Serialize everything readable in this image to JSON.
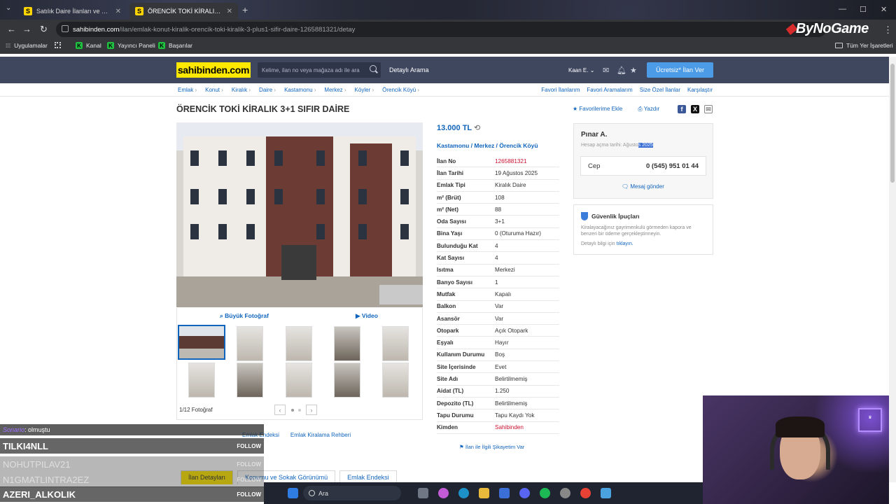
{
  "browser": {
    "tabs": [
      {
        "title": "Satılık Daire İlanları ve Satılık Ev",
        "favicon": "S"
      },
      {
        "title": "ÖRENCİK TOKİ KİRALIK 3+1 SIFIR",
        "favicon": "S"
      }
    ],
    "url_domain": "sahibinden.com",
    "url_path": "/ilan/emlak-konut-kiralik-orencik-toki-kiralik-3-plus1-sifir-daire-1265881321/detay",
    "overlay_logo": "ByNoGame",
    "bookmarks": [
      "Uygulamalar",
      "Kanal",
      "Yayıncı Paneli",
      "Başarılar"
    ],
    "all_bookmarks": "Tüm Yer İşaretleri"
  },
  "site": {
    "logo": "sahibinden.com",
    "search_placeholder": "Kelime, ilan no veya mağaza adı ile ara",
    "detailed_search": "Detaylı Arama",
    "user": "Kaan E.",
    "post_button": "Ücretsiz* İlan Ver"
  },
  "breadcrumb": [
    "Emlak",
    "Konut",
    "Kiralık",
    "Daire",
    "Kastamonu",
    "Merkez",
    "Köyler",
    "Örencik Köyü"
  ],
  "top_links": [
    "Favori İlanlarım",
    "Favori Aramalarım",
    "Size Özel İlanlar",
    "Karşılaştır"
  ],
  "ad": {
    "title": "ÖRENCİK TOKİ KİRALIK 3+1 SIFIR DAİRE",
    "favorite": "Favorilerime Ekle",
    "print": "Yazdır",
    "price": "13.000 TL",
    "location": "Kastamonu  /  Merkez  /  Örencik Köyü",
    "big_photo": "Büyük Fotoğraf",
    "video": "Video",
    "photo_count": "1/12 Fotoğraf",
    "complaint": "İlan ile İlgili Şikayetim Var",
    "details": [
      {
        "k": "İlan No",
        "v": "1265881321",
        "red": true
      },
      {
        "k": "İlan Tarihi",
        "v": "19 Ağustos 2025"
      },
      {
        "k": "Emlak Tipi",
        "v": "Kiralık Daire"
      },
      {
        "k": "m² (Brüt)",
        "v": "108"
      },
      {
        "k": "m² (Net)",
        "v": "88"
      },
      {
        "k": "Oda Sayısı",
        "v": "3+1"
      },
      {
        "k": "Bina Yaşı",
        "v": "0 (Oturuma Hazır)"
      },
      {
        "k": "Bulunduğu Kat",
        "v": "4"
      },
      {
        "k": "Kat Sayısı",
        "v": "4"
      },
      {
        "k": "Isıtma",
        "v": "Merkezi"
      },
      {
        "k": "Banyo Sayısı",
        "v": "1"
      },
      {
        "k": "Mutfak",
        "v": "Kapalı"
      },
      {
        "k": "Balkon",
        "v": "Var"
      },
      {
        "k": "Asansör",
        "v": "Var"
      },
      {
        "k": "Otopark",
        "v": "Açık Otopark"
      },
      {
        "k": "Eşyalı",
        "v": "Hayır"
      },
      {
        "k": "Kullanım Durumu",
        "v": "Boş"
      },
      {
        "k": "Site İçerisinde",
        "v": "Evet"
      },
      {
        "k": "Site Adı",
        "v": "Belirtilmemiş"
      },
      {
        "k": "Aidat (TL)",
        "v": "1.250"
      },
      {
        "k": "Depozito (TL)",
        "v": "Belirtilmemiş"
      },
      {
        "k": "Tapu Durumu",
        "v": "Tapu Kaydı Yok"
      },
      {
        "k": "Kimden",
        "v": "Sahibinden",
        "red": true
      }
    ]
  },
  "seller": {
    "name": "Pınar A.",
    "since_prefix": "Hesap açma tarihi: Ağusto",
    "since_highlight": "s 2025",
    "phone_label": "Cep",
    "phone": "0 (545) 951 01 44",
    "message": "Mesaj gönder"
  },
  "security": {
    "title": "Güvenlik İpuçları",
    "text": "Kiralayacağınız gayrimenkulü görmeden kapora ve benzeri bir ödeme gerçekleştirmeyin.",
    "link_prefix": "Detaylı bilgi için",
    "link": "tıklayın."
  },
  "links_row": [
    "Emlak Endeksi",
    "Emlak Kiralama Rehberi"
  ],
  "bottom_tabs": [
    "İlan Detayları",
    "Konumu ve Sokak Görünümü",
    "Emlak Endeksi"
  ],
  "overlay": {
    "chat_user": "Sonario",
    "chat_msg": ": olmuştu",
    "followers": [
      "TILKI4NLL",
      "NOHUTPILAV21",
      "N1GMATLINTRA2EZ",
      "AZERI_ALKOLIK"
    ],
    "follow_label": "FOLLOW",
    "taskbar_search": "Ara"
  }
}
